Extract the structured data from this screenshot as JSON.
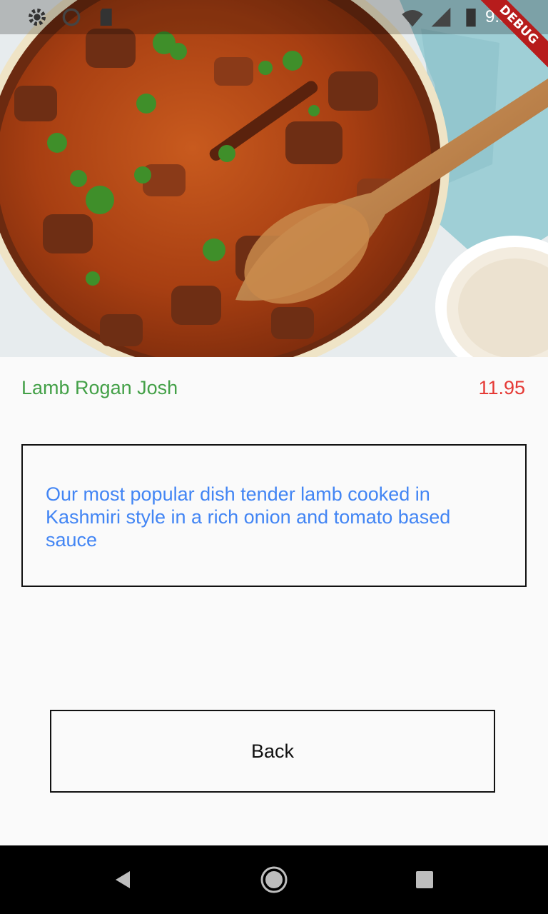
{
  "status_bar": {
    "time": "9:51",
    "icons": [
      "settings-icon",
      "sync-icon",
      "sd-card-icon",
      "wifi-icon",
      "signal-icon",
      "battery-icon"
    ]
  },
  "debug_banner": {
    "label": "DEBUG"
  },
  "hero_image": {
    "description_icon": "curry-photo"
  },
  "dish": {
    "name": "Lamb Rogan Josh",
    "price": "11.95",
    "description": "Our most popular dish tender lamb cooked in Kashmiri style in a rich onion and tomato based sauce"
  },
  "actions": {
    "back_label": "Back"
  },
  "nav_bar": {
    "icons": [
      "back-triangle-icon",
      "home-circle-icon",
      "recents-square-icon"
    ]
  },
  "colors": {
    "name": "#43a047",
    "price": "#e53935",
    "description": "#4285f4",
    "border": "#111111"
  }
}
